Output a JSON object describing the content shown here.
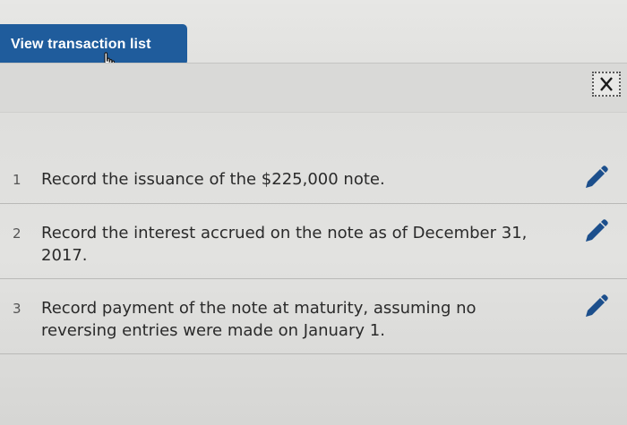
{
  "header": {
    "view_transactions_label": "View transaction list"
  },
  "toolbar": {
    "close_icon": "close-icon"
  },
  "transactions": [
    {
      "number": "1",
      "text": "Record the issuance of the $225,000 note.",
      "icon": "pencil-icon"
    },
    {
      "number": "2",
      "text": "Record the interest accrued on the note as of December 31, 2017.",
      "icon": "pencil-icon"
    },
    {
      "number": "3",
      "text": "Record payment of the note at maturity, assuming no reversing entries were made on January 1.",
      "icon": "pencil-icon"
    }
  ],
  "colors": {
    "button_bg": "#1f5c9c",
    "edit_icon": "#1c4f8c"
  }
}
